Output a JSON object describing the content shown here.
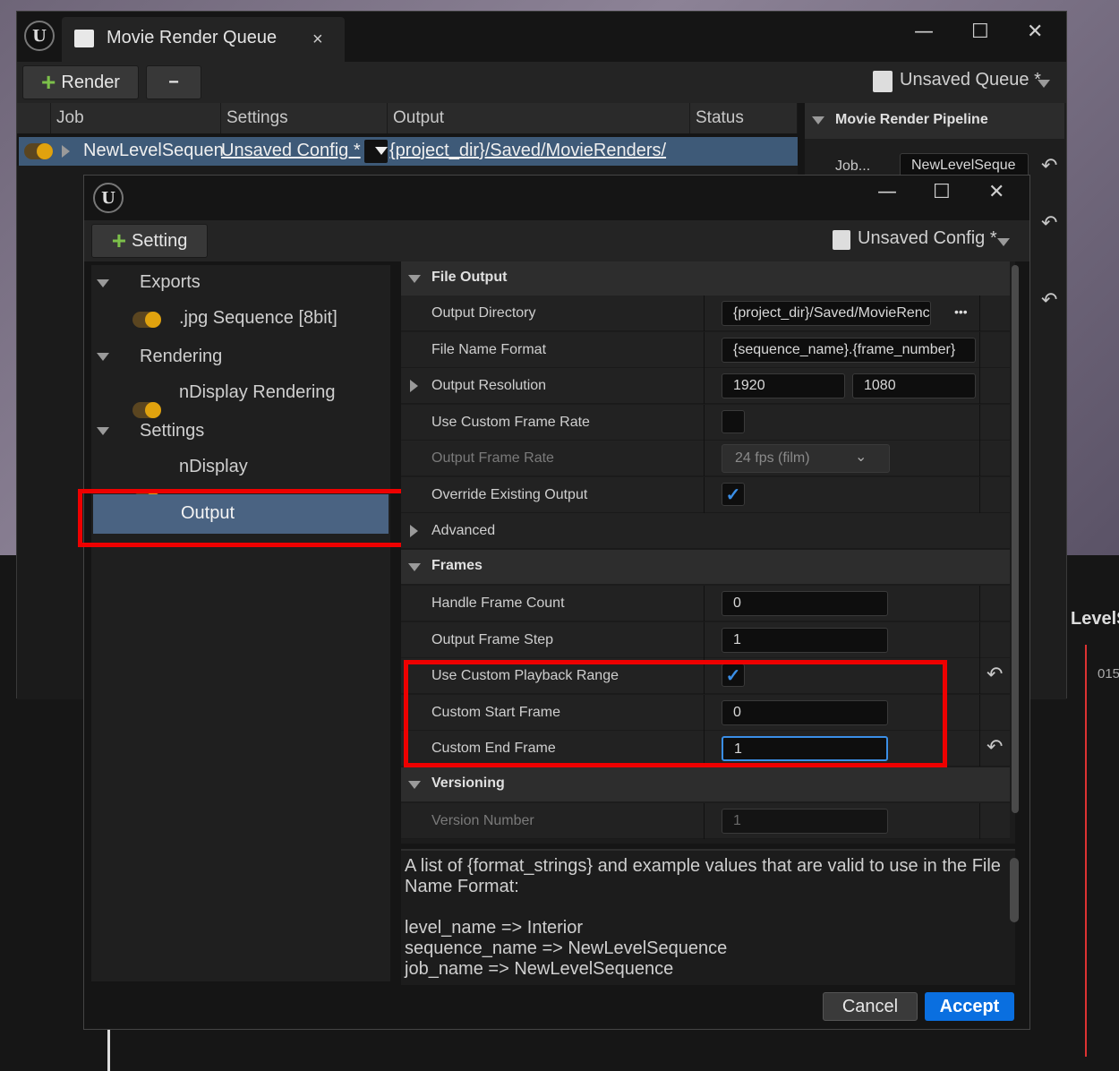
{
  "mrq": {
    "title": "Movie Render Queue",
    "tab_close": "×",
    "render_label": "Render",
    "remove_label": "−",
    "queue_name": "Unsaved Queue *",
    "columns": [
      "Job",
      "Settings",
      "Output",
      "Status"
    ],
    "job": {
      "name": "NewLevelSequen",
      "settings": "Unsaved Config *",
      "output": "{project_dir}/Saved/MovieRenders/"
    },
    "pipeline_title": "Movie Render Pipeline",
    "pipeline_job_label": "Job...",
    "pipeline_job_value": "NewLevelSeque",
    "timeline_text": "LevelS",
    "timeline_num": "015"
  },
  "window": {
    "minimize": "—",
    "maximize": "☐",
    "close": "✕"
  },
  "config": {
    "add_setting_label": "Setting",
    "config_name": "Unsaved Config *",
    "tree": {
      "exports": "Exports",
      "jpg": ".jpg Sequence [8bit]",
      "rendering": "Rendering",
      "ndisplay_rendering": "nDisplay Rendering",
      "settings": "Settings",
      "ndisplay": "nDisplay",
      "output": "Output"
    },
    "file_output": {
      "header": "File Output",
      "output_directory_label": "Output Directory",
      "output_directory_value": "{project_dir}/Saved/MovieRenc",
      "browse": "•••",
      "file_name_format_label": "File Name Format",
      "file_name_format_value": "{sequence_name}.{frame_number}",
      "output_resolution_label": "Output Resolution",
      "res_x": "1920",
      "res_y": "1080",
      "use_custom_frame_rate_label": "Use Custom Frame Rate",
      "output_frame_rate_label": "Output Frame Rate",
      "output_frame_rate_value": "24 fps (film)",
      "override_existing_label": "Override Existing Output",
      "advanced_label": "Advanced"
    },
    "frames": {
      "header": "Frames",
      "handle_frame_count_label": "Handle Frame Count",
      "handle_frame_count_value": "0",
      "output_frame_step_label": "Output Frame Step",
      "output_frame_step_value": "1",
      "use_custom_playback_range_label": "Use Custom Playback Range",
      "custom_start_frame_label": "Custom Start Frame",
      "custom_start_frame_value": "0",
      "custom_end_frame_label": "Custom End Frame",
      "custom_end_frame_value": "1"
    },
    "versioning": {
      "header": "Versioning",
      "version_number_label": "Version Number",
      "version_number_value": "1"
    },
    "description": {
      "line1": "A list of {format_strings} and example values that are valid to use in the File",
      "line2": "Name Format:",
      "line3": "level_name => Interior",
      "line4": "sequence_name => NewLevelSequence",
      "line5": "job_name => NewLevelSequence"
    },
    "cancel_label": "Cancel",
    "accept_label": "Accept"
  },
  "colors": {
    "accent": "#0a6fe0",
    "highlight_red": "#ee0000",
    "toggle_on": "#e0a20e",
    "selection": "#4a6382"
  }
}
